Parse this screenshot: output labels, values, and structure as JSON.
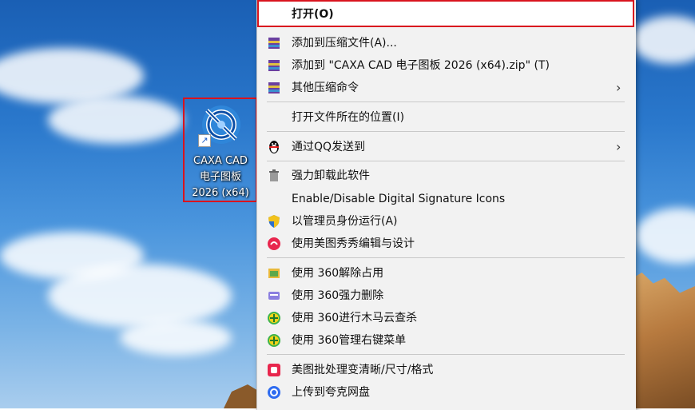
{
  "desktop_icon": {
    "name_lines": [
      "CAXA CAD",
      "电子图板",
      "2026 (x64)"
    ]
  },
  "context_menu": {
    "open": "打开(O)",
    "add_to_archive": "添加到压缩文件(A)...",
    "add_to_zip": "添加到 \"CAXA CAD 电子图板 2026 (x64).zip\" (T)",
    "other_compress": "其他压缩命令",
    "open_location": "打开文件所在的位置(I)",
    "send_qq": "通过QQ发送到",
    "force_uninstall": "强力卸载此软件",
    "digital_signature": "Enable/Disable Digital Signature Icons",
    "run_as_admin": "以管理员身份运行(A)",
    "meitu_edit": "使用美图秀秀编辑与设计",
    "unlock_360": "使用 360解除占用",
    "delete_360": "使用 360强力删除",
    "trojan_360": "使用 360进行木马云查杀",
    "manage_menu_360": "使用 360管理右键菜单",
    "meitu_batch": "美图批处理变清晰/尺寸/格式",
    "upload_quark": "上传到夸克网盘"
  },
  "colors": {
    "highlight_border": "#d9141e",
    "menu_bg": "#f2f2f2"
  }
}
